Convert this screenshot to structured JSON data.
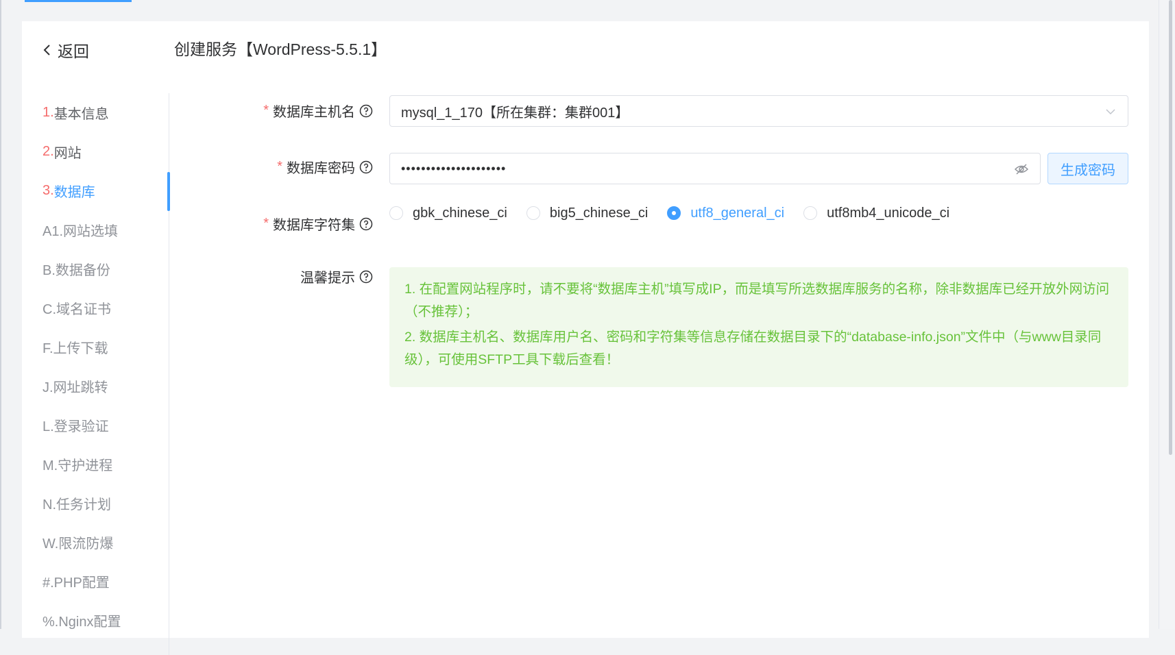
{
  "header": {
    "back_label": "返回",
    "title": "创建服务【WordPress-5.5.1】"
  },
  "steps": [
    {
      "num": "1.",
      "label": "基本信息"
    },
    {
      "num": "2.",
      "label": "网站"
    },
    {
      "num": "3.",
      "label": "数据库"
    },
    {
      "num": "",
      "label": "A1.网站选填"
    },
    {
      "num": "",
      "label": "B.数据备份"
    },
    {
      "num": "",
      "label": "C.域名证书"
    },
    {
      "num": "",
      "label": "F.上传下载"
    },
    {
      "num": "",
      "label": "J.网址跳转"
    },
    {
      "num": "",
      "label": "L.登录验证"
    },
    {
      "num": "",
      "label": "M.守护进程"
    },
    {
      "num": "",
      "label": "N.任务计划"
    },
    {
      "num": "",
      "label": "W.限流防爆"
    },
    {
      "num": "",
      "label": "#.PHP配置"
    },
    {
      "num": "",
      "label": "%.Nginx配置"
    }
  ],
  "form": {
    "required_mark": "*",
    "host_label": "数据库主机名",
    "host_value": "mysql_1_170【所在集群：集群001】",
    "password_label": "数据库密码",
    "password_value": "•••••••••••••••••••••",
    "generate_label": "生成密码",
    "charset_label": "数据库字符集",
    "charset_options": [
      "gbk_chinese_ci",
      "big5_chinese_ci",
      "utf8_general_ci",
      "utf8mb4_unicode_ci"
    ],
    "charset_selected": "utf8_general_ci",
    "tip_label": "温馨提示",
    "tip_lines": [
      "1. 在配置网站程序时，请不要将“数据库主机”填写成IP，而是填写所选数据库服务的名称，除非数据库已经开放外网访问（不推荐）；",
      "2. 数据库主机名、数据库用户名、密码和字符集等信息存储在数据目录下的“database-info.json”文件中（与www目录同级），可使用SFTP工具下载后查看！"
    ]
  },
  "icons": {
    "back": "chevron-left-icon",
    "help": "question-circle-icon",
    "dropdown": "chevron-down-icon",
    "visibility": "eye-off-icon"
  },
  "colors": {
    "primary": "#409eff",
    "danger": "#f56c6c",
    "success": "#67c23a",
    "success_bg": "#f0f9eb"
  }
}
